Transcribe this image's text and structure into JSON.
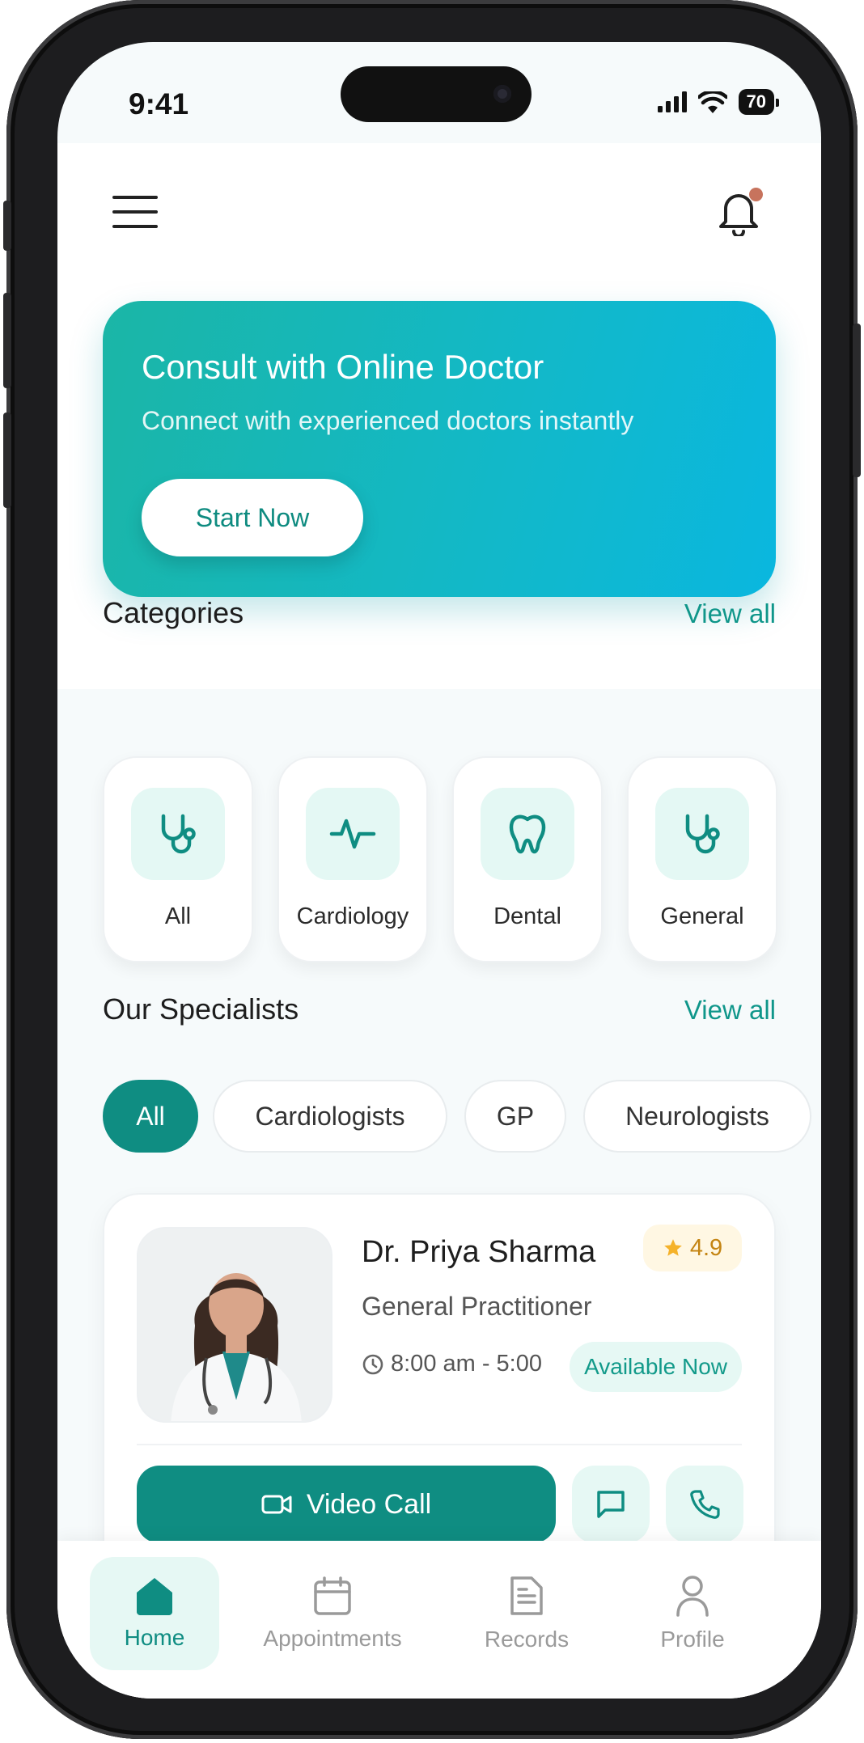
{
  "status_bar": {
    "time": "9:41",
    "battery": "70"
  },
  "hero": {
    "title": "Consult with Online Doctor",
    "subtitle": "Connect with experienced doctors instantly",
    "button_label": "Start Now"
  },
  "categories": {
    "title": "Categories",
    "view_all": "View all",
    "items": [
      {
        "label": "All",
        "icon": "stethoscope-icon"
      },
      {
        "label": "Cardiology",
        "icon": "heartbeat-icon"
      },
      {
        "label": "Dental",
        "icon": "tooth-icon"
      },
      {
        "label": "General",
        "icon": "stethoscope-icon"
      }
    ]
  },
  "specialists": {
    "title": "Our Specialists",
    "view_all": "View all",
    "filters": [
      {
        "label": "All",
        "active": true
      },
      {
        "label": "Cardiologists",
        "active": false
      },
      {
        "label": "GP",
        "active": false
      },
      {
        "label": "Neurologists",
        "active": false
      }
    ],
    "doctor": {
      "name": "Dr. Priya Sharma",
      "rating": "4.9",
      "specialty": "General Practitioner",
      "hours": "8:00 am - 5:00",
      "availability": "Available Now",
      "video_call_label": "Video Call"
    }
  },
  "tabs": [
    {
      "label": "Home",
      "icon": "home-icon",
      "active": true
    },
    {
      "label": "Appointments",
      "icon": "calendar-icon",
      "active": false
    },
    {
      "label": "Records",
      "icon": "document-icon",
      "active": false
    },
    {
      "label": "Profile",
      "icon": "user-icon",
      "active": false
    }
  ],
  "colors": {
    "primary": "#0f8d82",
    "hero_start": "#1bb6a6",
    "hero_end": "#0ab7df",
    "notification_dot": "#c7735d",
    "star": "#f5b22a"
  }
}
